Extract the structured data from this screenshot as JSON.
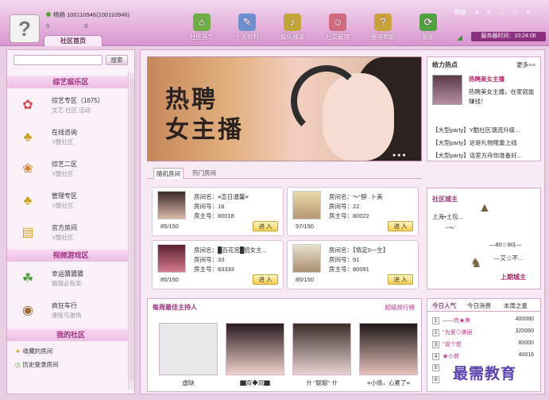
{
  "header": {
    "user_line": "杨扬 100110946(100110946)",
    "coin1": "0",
    "coin2": "0",
    "tab_home": "社区首页",
    "nav": [
      "社区首页",
      "个人资料",
      "娱乐频道",
      "社交管理",
      "使用帮助",
      "刷新"
    ],
    "win_controls": [
      "帮助",
      "▾",
      "▾",
      "—",
      "□",
      "✕"
    ],
    "server_time": "服务器时间：10:24:06"
  },
  "sidebar": {
    "search_button": "搜索",
    "sec1": "综艺娱乐区",
    "items1": [
      {
        "name": "综艺专区（1675）",
        "sub": "文艺 社区 活动"
      },
      {
        "name": "在线咨询",
        "sub": "Y酷社区"
      },
      {
        "name": "综艺二区",
        "sub": "Y酷社区"
      },
      {
        "name": "管理专区",
        "sub": "Y酷社区"
      },
      {
        "name": "官方房间",
        "sub": "Y酷社区"
      }
    ],
    "sec2": "视频游戏区",
    "items2": [
      {
        "name": "幸运猜猜猜",
        "sub": "猜猜必有奖"
      },
      {
        "name": "疯狂车行",
        "sub": "速度与激情"
      }
    ],
    "sec3": "我的社区",
    "links": [
      "收藏的房间",
      "历史登录房间"
    ]
  },
  "banner": {
    "line1": "热聘",
    "line2": "女主播"
  },
  "hot": {
    "title": "给力热点",
    "more": "更多>>",
    "item_title": "热聘美女主播",
    "item_desc": "热聘美女主播，在家就能赚钱！",
    "lines": [
      "【大型party】Y酷社区潮流升级...",
      "【大型party】这是礼物隆重上线",
      "【大型party】话室方舟你准备好..."
    ]
  },
  "room_tabs": [
    "随机房间",
    "热门房间"
  ],
  "rooms": [
    {
      "name": "房间名：≡恋日温馨≡",
      "num": "房间号：18",
      "owner": "房主号：80018",
      "count": "85/150",
      "enter": "进 入"
    },
    {
      "name": "房间名：〜°醉 ·卜美",
      "num": "房间号：22",
      "owner": "房主号：80022",
      "count": "97/150",
      "enter": "进 入"
    },
    {
      "name": "房间名：█百花宫█招女主...",
      "num": "房间号：33",
      "owner": "房主号：83333",
      "count": "85/150",
      "enter": "进 入"
    },
    {
      "name": "房间名：【情定0一生】",
      "num": "房间号：91",
      "owner": "房主号：80091",
      "count": "85/150",
      "enter": "进 入"
    }
  ],
  "city": {
    "title": "社区城主",
    "t1": "上海•土包...",
    "t2": "~〜`",
    "t3": "—80☆80|—",
    "t4": "—艾☆不...",
    "lord": "上期城主"
  },
  "weekly": {
    "title": "每周最佳主持人",
    "rank": "超级排行榜",
    "hosts": [
      "虚缺",
      "▇双◆双▇",
      "卄 \"聪聪\" 卄",
      "≡小倩，心累了≡"
    ]
  },
  "ranking": {
    "tabs": [
      "今日人气",
      "今日消费",
      "本周之星"
    ],
    "rows": [
      {
        "n": "1",
        "name": "——完★美",
        "v": "400080"
      },
      {
        "n": "2",
        "name": "°为爱⊙美丽",
        "v": "320060"
      },
      {
        "n": "3",
        "name": "°说个想",
        "v": "80000"
      },
      {
        "n": "4",
        "name": "★小郎",
        "v": "40016"
      },
      {
        "n": "5",
        "name": "",
        "v": ""
      },
      {
        "n": "6",
        "name": "",
        "v": ""
      }
    ]
  },
  "watermark": "最需教育"
}
